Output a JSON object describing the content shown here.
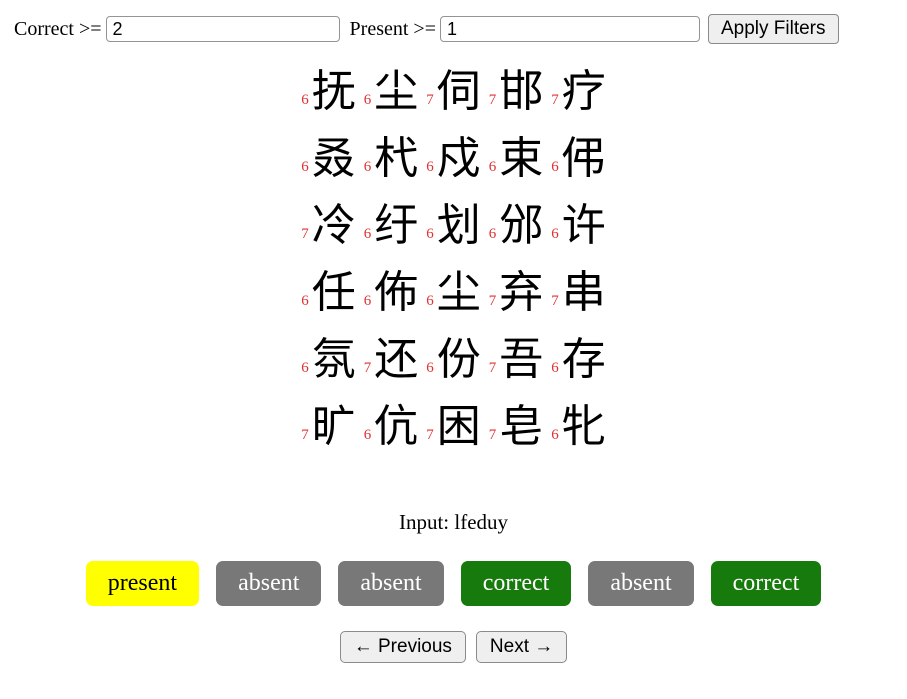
{
  "filters": {
    "correct_label": "Correct >=",
    "correct_value": "2",
    "present_label": "Present >=",
    "present_value": "1",
    "apply_label": "Apply Filters"
  },
  "grid": {
    "rows": [
      [
        {
          "count": "6",
          "char": "抚"
        },
        {
          "count": "6",
          "char": "尘"
        },
        {
          "count": "7",
          "char": "伺"
        },
        {
          "count": "7",
          "char": "邯"
        },
        {
          "count": "7",
          "char": "疗"
        }
      ],
      [
        {
          "count": "6",
          "char": "叒"
        },
        {
          "count": "6",
          "char": "杙"
        },
        {
          "count": "6",
          "char": "戍"
        },
        {
          "count": "6",
          "char": "束"
        },
        {
          "count": "6",
          "char": "伄"
        }
      ],
      [
        {
          "count": "7",
          "char": "冷"
        },
        {
          "count": "6",
          "char": "纡"
        },
        {
          "count": "6",
          "char": "划"
        },
        {
          "count": "6",
          "char": "邠"
        },
        {
          "count": "6",
          "char": "许"
        }
      ],
      [
        {
          "count": "6",
          "char": "任"
        },
        {
          "count": "6",
          "char": "佈"
        },
        {
          "count": "6",
          "char": "尘"
        },
        {
          "count": "7",
          "char": "弃"
        },
        {
          "count": "7",
          "char": "串"
        }
      ],
      [
        {
          "count": "6",
          "char": "氛"
        },
        {
          "count": "7",
          "char": "还"
        },
        {
          "count": "6",
          "char": "份"
        },
        {
          "count": "7",
          "char": "吾"
        },
        {
          "count": "6",
          "char": "存"
        }
      ],
      [
        {
          "count": "7",
          "char": "旷"
        },
        {
          "count": "6",
          "char": "伉"
        },
        {
          "count": "7",
          "char": "困"
        },
        {
          "count": "7",
          "char": "皂"
        },
        {
          "count": "6",
          "char": "牝"
        }
      ]
    ]
  },
  "input_line": "Input: lfeduy",
  "badges": [
    {
      "label": "present",
      "state": "present"
    },
    {
      "label": "absent",
      "state": "absent"
    },
    {
      "label": "absent",
      "state": "absent"
    },
    {
      "label": "correct",
      "state": "correct"
    },
    {
      "label": "absent",
      "state": "absent"
    },
    {
      "label": "correct",
      "state": "correct"
    }
  ],
  "nav": {
    "previous_label": "← Previous",
    "next_label": "Next →"
  },
  "colors": {
    "present": "#ffff00",
    "absent": "#787878",
    "correct": "#177a0d",
    "count": "#e03030"
  }
}
